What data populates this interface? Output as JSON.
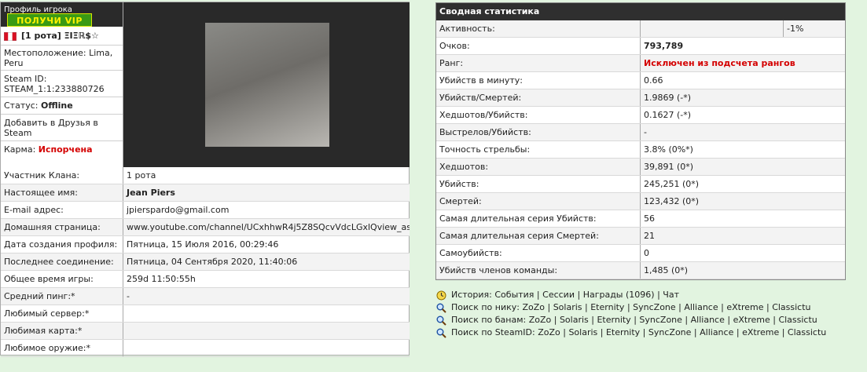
{
  "profile": {
    "header_title": "Профиль игрока",
    "vip_button": "ПОЛУЧИ VIP",
    "player_name": "[1 рота] ΞΙΞℝ$☆",
    "location_label": "Местоположение:",
    "location_value": "Lima, Peru",
    "steam_id_label": "Steam ID:",
    "steam_id_value": "STEAM_1:1:233880726",
    "status_label": "Статус:",
    "status_value": "Offline",
    "add_friend": "Добавить в Друзья в Steam",
    "karma_label": "Карма:",
    "karma_value": "Испорчена",
    "rows": [
      {
        "label": "Участник Клана:",
        "value": " 1 рота"
      },
      {
        "label": "Настоящее имя:",
        "value": "Jean Piers"
      },
      {
        "label": "E-mail адрес:",
        "value": "jpierspardo@gmail.com"
      },
      {
        "label": "Домашняя страница:",
        "value": "www.youtube.com/channel/UCxhhwR4j5Z8SQcvVdcLGxlQview_as"
      },
      {
        "label": "Дата создания профиля:",
        "value": "Пятница, 15 Июля 2016, 00:29:46"
      },
      {
        "label": "Последнее соединение:",
        "value": "Пятница, 04 Сентября 2020, 11:40:06"
      },
      {
        "label": "Общее время игры:",
        "value": "259d 11:50:55h"
      },
      {
        "label": "Средний пинг:*",
        "value": "-"
      },
      {
        "label": "Любимый сервер:*",
        "value": ""
      },
      {
        "label": "Любимая карта:*",
        "value": ""
      },
      {
        "label": "Любимое оружие:*",
        "value": ""
      }
    ]
  },
  "stats": {
    "title": "Сводная статистика",
    "activity_label": "Активность:",
    "activity_value": "-1%",
    "rows": [
      {
        "label": "Очков:",
        "value": "793,789"
      },
      {
        "label": "Ранг:",
        "value": "Исключен из подсчета рангов"
      },
      {
        "label": "Убийств в минуту:",
        "value": "0.66"
      },
      {
        "label": "Убийств/Смертей:",
        "value": "1.9869 (-*)"
      },
      {
        "label": "Хедшотов/Убийств:",
        "value": "0.1627 (-*)"
      },
      {
        "label": "Выстрелов/Убийств:",
        "value": "-"
      },
      {
        "label": "Точность стрельбы:",
        "value": "3.8% (0%*)"
      },
      {
        "label": "Хедшотов:",
        "value": "39,891 (0*)"
      },
      {
        "label": "Убийств:",
        "value": "245,251 (0*)"
      },
      {
        "label": "Смертей:",
        "value": "123,432 (0*)"
      },
      {
        "label": "Самая длительная серия Убийств:",
        "value": "56"
      },
      {
        "label": "Самая длительная серия Смертей:",
        "value": "21"
      },
      {
        "label": "Самоубийств:",
        "value": "0"
      },
      {
        "label": "Убийств членов команды:",
        "value": "1,485 (0*)"
      }
    ]
  },
  "links": {
    "history_label": "История:",
    "history_items": [
      "События",
      "Сессии",
      "Награды (1096)",
      "Чат"
    ],
    "search_rows": [
      {
        "label": "Поиск по нику:",
        "items": [
          "ZoZo",
          "Solaris",
          "Eternity",
          "SyncZone",
          "Alliance",
          "eXtreme",
          "Classictu"
        ]
      },
      {
        "label": "Поиск по банам:",
        "items": [
          "ZoZo",
          "Solaris",
          "Eternity",
          "SyncZone",
          "Alliance",
          "eXtreme",
          "Classictu"
        ]
      },
      {
        "label": "Поиск по SteamID:",
        "items": [
          "ZoZo",
          "Solaris",
          "Eternity",
          "SyncZone",
          "Alliance",
          "eXtreme",
          "Classictu"
        ]
      }
    ]
  },
  "icons": {
    "flag": "peru-flag-icon",
    "history": "clock-icon",
    "search": "magnifier-icon"
  },
  "colors": {
    "page_bg": "#e2f4e0",
    "header_bg": "#2f2f2f",
    "alert_red": "#d40000",
    "vip_green": "#3a9a14",
    "vip_text": "#fff200"
  }
}
